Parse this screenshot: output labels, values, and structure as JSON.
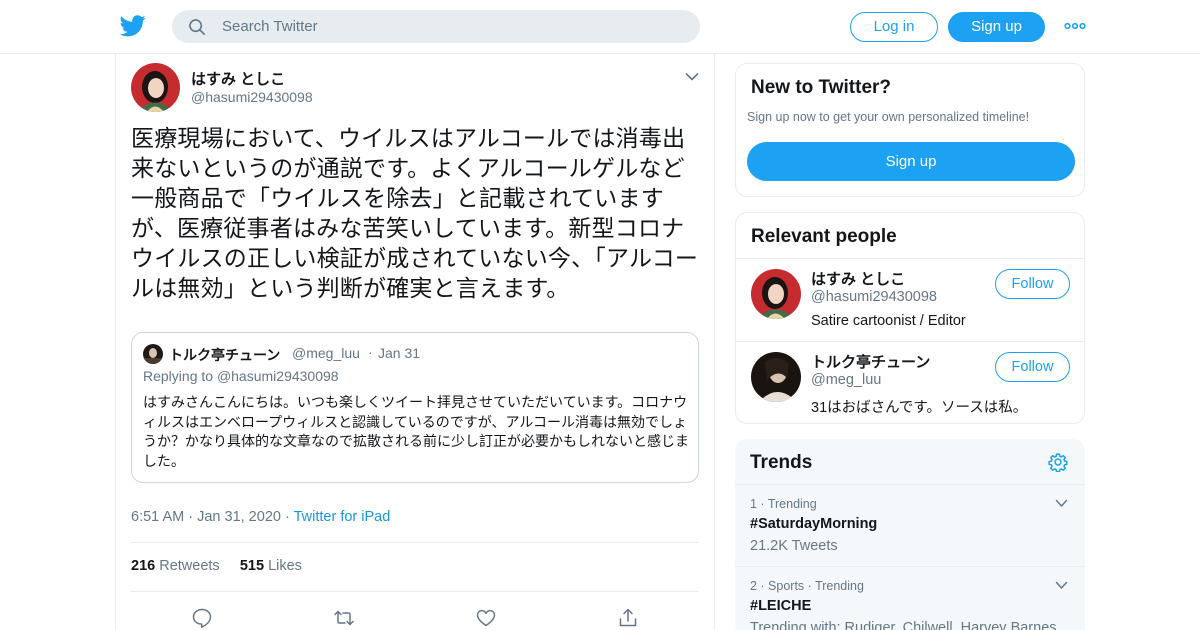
{
  "header": {
    "search_placeholder": "Search Twitter",
    "login_label": "Log in",
    "signup_label": "Sign up"
  },
  "tweet": {
    "author_name": "はすみ としこ",
    "author_handle": "@hasumi29430098",
    "text": "医療現場において、ウイルスはアルコールでは消毒出来ないというのが通説です。よくアルコールゲルなど一般商品で「ウイルスを除去」と記載されていますが、医療従事者はみな苦笑いしています。新型コロナウイルスの正しい検証が成されていない今、「アルコールは無効」という判断が確実と言えます。",
    "quote": {
      "name": "トルク亭チューン",
      "handle": "@meg_luu",
      "date": "Jan 31",
      "replying_prefix": "Replying to",
      "replying_to": "@hasumi29430098",
      "text": "はすみさんこんにちは。いつも楽しくツイート拝見させていただいています。コロナウィルスはエンベロープウィルスと認識しているのですが、アルコール消毒は無効でしょうか？かなり具体的な文章なので拡散される前に少し訂正が必要かもしれないと感じました。"
    },
    "time": "6:51 AM",
    "date": "Jan 31, 2020",
    "via": "Twitter for iPad",
    "retweets_count": "216",
    "retweets_label": "Retweets",
    "likes_count": "515",
    "likes_label": "Likes"
  },
  "sidebar": {
    "new_to_twitter": {
      "title": "New to Twitter?",
      "subtitle": "Sign up now to get your own personalized timeline!",
      "button": "Sign up"
    },
    "relevant_people": {
      "title": "Relevant people",
      "people": [
        {
          "name": "はすみ としこ",
          "handle": "@hasumi29430098",
          "bio": "Satire cartoonist / Editor",
          "follow": "Follow"
        },
        {
          "name": "トルク亭チューン",
          "handle": "@meg_luu",
          "bio": "31はおばさんです。ソースは私。",
          "follow": "Follow"
        }
      ]
    },
    "trends": {
      "title": "Trends",
      "items": [
        {
          "meta": "1 · Trending",
          "name": "#SaturdayMorning",
          "sub": "21.2K Tweets"
        },
        {
          "meta": "2 · Sports · Trending",
          "name": "#LEICHE",
          "sub": "Trending with: Rudiger, Chilwell, Harvey Barnes"
        }
      ]
    }
  },
  "colors": {
    "accent": "#1da1f2",
    "text": "#14171a",
    "muted": "#657786",
    "border": "#e6ecf0"
  }
}
